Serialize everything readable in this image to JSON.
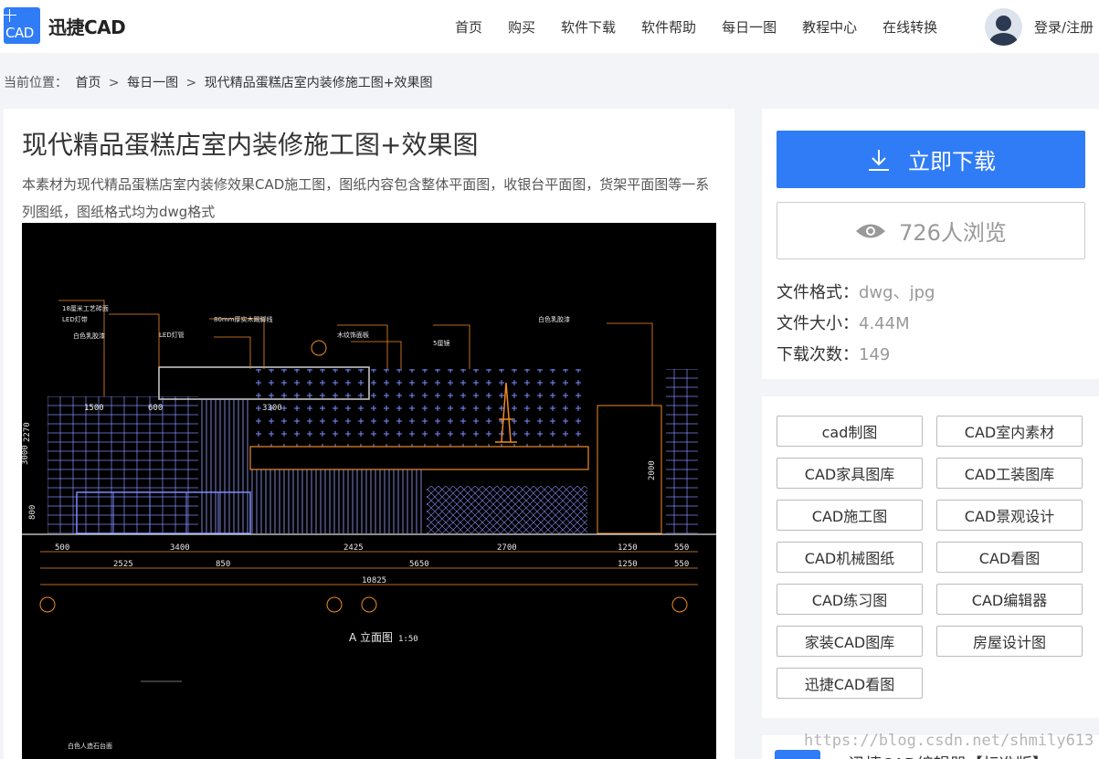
{
  "header": {
    "logo_text": "迅捷CAD",
    "logo_icon_text": "CAD",
    "nav": [
      "首页",
      "购买",
      "软件下载",
      "软件帮助",
      "每日一图",
      "教程中心",
      "在线转换"
    ],
    "login": "登录/注册"
  },
  "breadcrumb": {
    "prefix": "当前位置：",
    "items": [
      "首页",
      "每日一图",
      "现代精品蛋糕店室内装修施工图+效果图"
    ],
    "separator": ">"
  },
  "main": {
    "title": "现代精品蛋糕店室内装修施工图+效果图",
    "description": "本素材为现代精品蛋糕店室内装修效果CAD施工图，图纸内容包含整体平面图，收银台平面图，货架平面图等一系列图纸，图纸格式均为dwg格式",
    "drawing": {
      "elevation_label": "A 立面图",
      "scale": "1:50",
      "dims_row1": [
        "500",
        "3400",
        "2425",
        "2700",
        "1250",
        "550"
      ],
      "dims_row2": [
        "2525",
        "850",
        "5650",
        "1250",
        "550"
      ],
      "total": "10825",
      "top_dims": [
        "1500",
        "600",
        "3300"
      ],
      "height_dims": [
        "2270",
        "3000",
        "800",
        "2000"
      ],
      "notes": [
        "18厘米工艺砖面",
        "LED灯带",
        "白色乳胶漆",
        "80mm厚实木踢脚线",
        "LED灯管",
        "5厘镜",
        "白色乳胶漆",
        "木纹饰面板",
        "白色人造石台面"
      ]
    }
  },
  "sidebar": {
    "download_label": "立即下载",
    "views_label": "726人浏览",
    "format_label": "文件格式：",
    "format_value": "dwg、jpg",
    "size_label": "文件大小：",
    "size_value": "4.44M",
    "downloads_label": "下载次数：",
    "downloads_value": "149",
    "tags": [
      "cad制图",
      "CAD室内素材",
      "CAD家具图库",
      "CAD工装图库",
      "CAD施工图",
      "CAD景观设计",
      "CAD机械图纸",
      "CAD看图",
      "CAD练习图",
      "CAD编辑器",
      "家装CAD图库",
      "房屋设计图",
      "迅捷CAD看图"
    ],
    "bottom_card_text": "迅捷CAD编辑器【标准版】"
  },
  "watermark": "https://blog.csdn.net/shmily613",
  "colors": {
    "accent": "#2f7cf6",
    "cad_bg": "#000000",
    "cad_orange": "#f08a24",
    "cad_blue": "#7b8cff"
  }
}
